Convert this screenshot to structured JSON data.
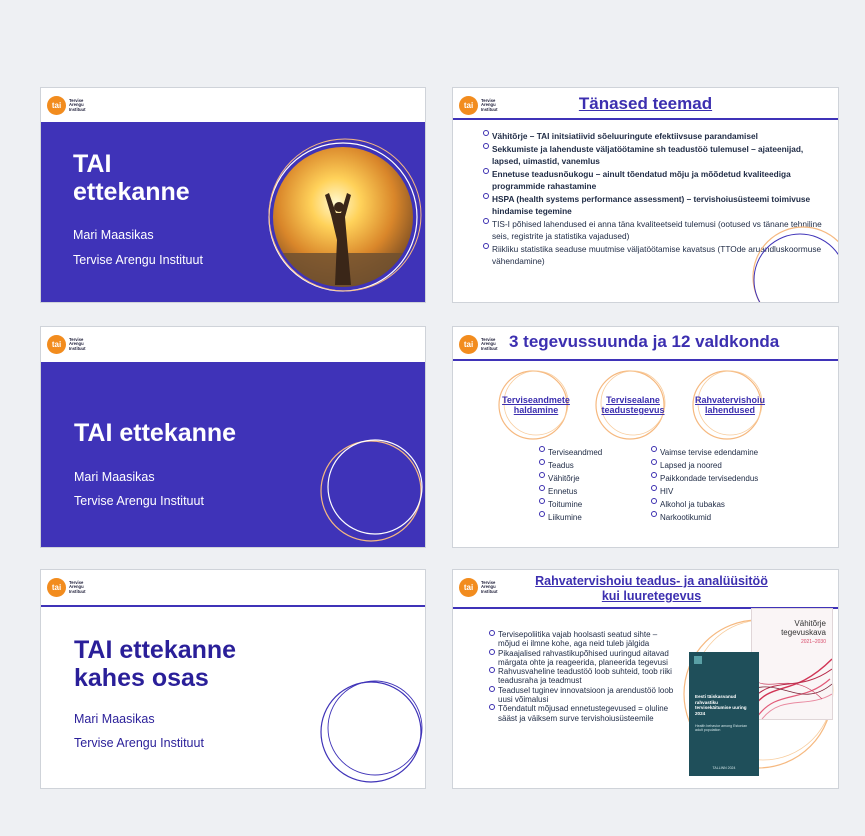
{
  "logo": {
    "badge": "tai",
    "line1": "Tervise",
    "line2": "Arengu",
    "line3": "Instituut"
  },
  "slide1": {
    "title_l1": "TAI",
    "title_l2": "ettekanne",
    "author": "Mari Maasikas",
    "org": "Tervise Arengu Instituut"
  },
  "slide2": {
    "title": "Tänased teemad",
    "items": [
      {
        "text": "Vähitõrje – TAI initsiatiivid sõeluuringute efektiivsuse parandamisel",
        "bold": true
      },
      {
        "text": "Sekkumiste ja lahenduste väljatöötamine sh teadustöö tulemusel – ajateenijad, lapsed, uimastid, vanemlus",
        "bold": true
      },
      {
        "text": "Ennetuse teadusnõukogu – ainult tõendatud mõju ja mõõdetud kvaliteediga programmide rahastamine",
        "bold": true
      },
      {
        "text": "HSPA (health systems performance assessment) – tervishoiusüsteemi toimivuse hindamise tegemine",
        "bold": true
      },
      {
        "text": "TIS-I põhised lahendused ei anna täna kvaliteetseid tulemusi (ootused vs tänane tehniline seis, registrite ja statistika vajadused)",
        "bold": false
      },
      {
        "text": "Riikliku statistika seaduse muutmise väljatöötamise kavatsus (TTOde aruandluskoormuse vähendamine)",
        "bold": false
      }
    ]
  },
  "slide3": {
    "title": "TAI ettekanne",
    "author": "Mari Maasikas",
    "org": "Tervise Arengu Instituut"
  },
  "slide4": {
    "title": "3 tegevussuunda ja 12 valdkonda",
    "circles": [
      {
        "l1": "Terviseandmete",
        "l2": "haldamine"
      },
      {
        "l1": "Tervisealane",
        "l2": "teadustegevus"
      },
      {
        "l1": "Rahvatervishoiu",
        "l2": "lahendused"
      }
    ],
    "left_items": [
      "Terviseandmed",
      "Teadus",
      "Vähitõrje",
      "Ennetus",
      "Toitumine",
      "Liikumine"
    ],
    "right_items": [
      "Vaimse tervise edendamine",
      "Lapsed ja noored",
      "Paikkondade tervisedendus",
      "HIV",
      "Alkohol ja tubakas",
      "Narkootikumid"
    ]
  },
  "slide5": {
    "title_l1": "TAI ettekanne",
    "title_l2": "kahes osas",
    "author": "Mari Maasikas",
    "org": "Tervise Arengu Instituut"
  },
  "slide6": {
    "title_l1": "Rahvatervishoiu teadus- ja analüüsitöö",
    "title_l2": "kui luuretegevus",
    "items": [
      "Tervisepoliitika vajab hoolsasti seatud sihte – mõjud ei ilmne kohe, aga neid tuleb jälgida",
      "Pikaajalised rahvastikupõhised uuringud aitavad märgata ohte ja reageerida, planeerida tegevusi",
      "Rahvusvaheline teadustöö loob suhteid, toob riiki teadusraha ja teadmust",
      "Teadusel tuginev innovatsioon ja arendustöö loob uusi võimalusi",
      "Tõendatult mõjusad ennetustegevused = oluline sääst ja väiksem surve tervishoiusüsteemile"
    ],
    "book1": {
      "title": "Eesti täiskasvanud rahvastiku tervisekäitumise uuring 2024",
      "sub": "Health behavior among Estonian adult population",
      "footer": "TALLINN 2024"
    },
    "book2": {
      "title_l1": "Vähitõrje",
      "title_l2": "tegevuskava",
      "years": "2021–2030"
    }
  },
  "colors": {
    "accent": "#3f33b8",
    "orange": "#f28c1e",
    "ring": "#f6b980"
  }
}
